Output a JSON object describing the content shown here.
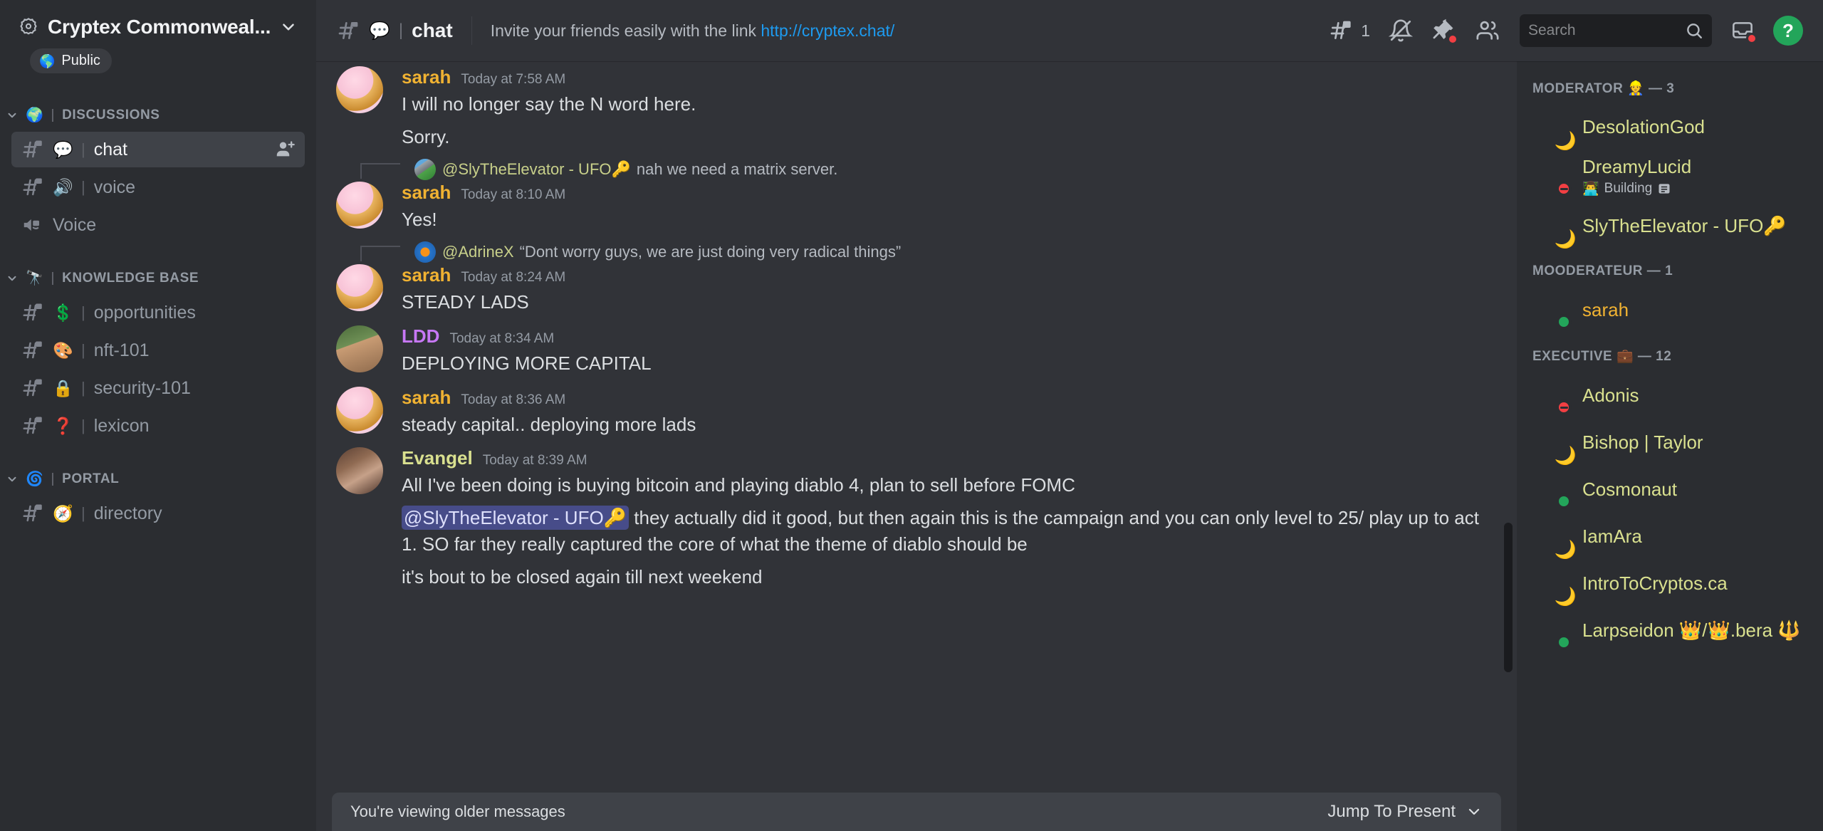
{
  "sidebar": {
    "server_name": "Cryptex Commonweal...",
    "privacy_label": "Public",
    "privacy_icon": "globe-icon",
    "categories": [
      {
        "label": "DISCUSSIONS",
        "emoji": "🌍",
        "channels": [
          {
            "emoji": "💬",
            "label": "chat",
            "active": true,
            "type": "text",
            "locked": true,
            "has_invite": true
          },
          {
            "emoji": "🔊",
            "label": "voice",
            "active": false,
            "type": "text",
            "locked": true,
            "has_invite": false
          },
          {
            "emoji": "",
            "label": "Voice",
            "active": false,
            "type": "voice",
            "locked": true,
            "has_invite": false
          }
        ]
      },
      {
        "label": "KNOWLEDGE BASE",
        "emoji": "🔭",
        "channels": [
          {
            "emoji": "💲",
            "label": "opportunities",
            "active": false,
            "type": "text",
            "locked": true,
            "has_invite": false
          },
          {
            "emoji": "🎨",
            "label": "nft-101",
            "active": false,
            "type": "text",
            "locked": true,
            "has_invite": false
          },
          {
            "emoji": "🔒",
            "label": "security-101",
            "active": false,
            "type": "text",
            "locked": true,
            "has_invite": false
          },
          {
            "emoji": "❓",
            "label": "lexicon",
            "active": false,
            "type": "text",
            "locked": true,
            "has_invite": false
          }
        ]
      },
      {
        "label": "PORTAL",
        "emoji": "🌀",
        "channels": [
          {
            "emoji": "🧭",
            "label": "directory",
            "active": false,
            "type": "text",
            "locked": true,
            "has_invite": false
          }
        ]
      }
    ]
  },
  "topbar": {
    "channel_emoji": "💬",
    "channel_name": "chat",
    "topic_prefix": "Invite your friends easily with the link",
    "topic_link": "http://cryptex.chat/",
    "threads_count": "1",
    "search_placeholder": "Search",
    "help_label": "?",
    "icons": [
      "threads-icon",
      "notification-off-icon",
      "pin-icon",
      "members-icon",
      "inbox-icon",
      "help-icon"
    ]
  },
  "messages": [
    {
      "id": "m1",
      "author": "sarah",
      "author_color": "#f0b232",
      "timestamp": "Today at 7:58 AM",
      "avatar_seed": "sarah",
      "lines": [
        "I will no longer say the N word here.",
        "Sorry."
      ],
      "reply": null
    },
    {
      "id": "m2",
      "author": "sarah",
      "author_color": "#f0b232",
      "timestamp": "Today at 8:10 AM",
      "avatar_seed": "sarah",
      "lines": [
        "Yes!"
      ],
      "reply": {
        "name": "@SlyTheElevator - UFO🔑",
        "text": "nah we need a matrix server.",
        "avatar_seed": "sly"
      }
    },
    {
      "id": "m3",
      "author": "sarah",
      "author_color": "#f0b232",
      "timestamp": "Today at 8:24 AM",
      "avatar_seed": "sarah",
      "lines": [
        "STEADY LADS"
      ],
      "reply": {
        "name": "@AdrineX",
        "text": "“Dont worry guys, we are just doing very radical things”",
        "avatar_seed": "adrine"
      }
    },
    {
      "id": "m4",
      "author": "LDD",
      "author_color": "#c778f5",
      "timestamp": "Today at 8:34 AM",
      "avatar_seed": "ldd",
      "lines": [
        "DEPLOYING MORE CAPITAL"
      ],
      "reply": null
    },
    {
      "id": "m5",
      "author": "sarah",
      "author_color": "#f0b232",
      "timestamp": "Today at 8:36 AM",
      "avatar_seed": "sarah",
      "lines": [
        "steady capital.. deploying more lads"
      ],
      "reply": null
    },
    {
      "id": "m6",
      "author": "Evangel",
      "author_color": "#d9e08f",
      "timestamp": "Today at 8:39 AM",
      "avatar_seed": "evangel",
      "lines": [],
      "reply": null,
      "rich_lines": [
        {
          "parts": [
            {
              "type": "text",
              "value": "All I've been doing is buying bitcoin and playing diablo 4, plan to sell before FOMC"
            }
          ]
        },
        {
          "parts": [
            {
              "type": "mention",
              "value": "@SlyTheElevator - UFO🔑"
            },
            {
              "type": "text",
              "value": " they actually did it good, but then again this is the campaign and you can only level to 25/ play up to act 1. SO far they really captured the core of what the theme of diablo should be"
            }
          ]
        },
        {
          "parts": [
            {
              "type": "text",
              "value": "it's bout to be closed again till next weekend"
            }
          ]
        }
      ]
    }
  ],
  "jump_bar": {
    "notice": "You're viewing older messages",
    "action_label": "Jump To Present"
  },
  "members": {
    "groups": [
      {
        "label": "MODERATOR 👷 — 3",
        "people": [
          {
            "name": "DesolationGod",
            "status": "idle",
            "status_glyph": "🌙",
            "activity": null,
            "avatar_seed": "desolation",
            "color": "green"
          },
          {
            "name": "DreamyLucid",
            "status": "dnd",
            "status_glyph": "",
            "activity": "Building",
            "activity_emoji": "👨‍💻",
            "activity_icon": "doc-icon",
            "avatar_seed": "dreamy",
            "color": "green"
          },
          {
            "name": "SlyTheElevator - UFO🔑",
            "status": "idle",
            "status_glyph": "🌙",
            "activity": null,
            "avatar_seed": "sly",
            "color": "green"
          }
        ]
      },
      {
        "label": "MOODERATEUR — 1",
        "people": [
          {
            "name": "sarah",
            "status": "online",
            "status_glyph": "",
            "activity": null,
            "avatar_seed": "sarah",
            "color": "yellow"
          }
        ]
      },
      {
        "label": "EXECUTIVE 💼 — 12",
        "people": [
          {
            "name": "Adonis",
            "status": "dnd",
            "status_glyph": "",
            "activity": null,
            "avatar_seed": "adonis",
            "color": "green"
          },
          {
            "name": "Bishop | Taylor",
            "status": "idle",
            "status_glyph": "🌙",
            "activity": null,
            "avatar_seed": "bishop",
            "color": "green"
          },
          {
            "name": "Cosmonaut",
            "status": "online",
            "status_glyph": "",
            "activity": null,
            "avatar_seed": "cosmonaut",
            "color": "green"
          },
          {
            "name": "IamAra",
            "status": "idle",
            "status_glyph": "🌙",
            "activity": null,
            "avatar_seed": "iamara",
            "color": "green"
          },
          {
            "name": "IntroToCryptos.ca",
            "status": "idle",
            "status_glyph": "🌙",
            "activity": null,
            "avatar_seed": "intro",
            "color": "green"
          },
          {
            "name": "Larpseidon 👑/👑.bera 🔱",
            "status": "online",
            "status_glyph": "",
            "activity": null,
            "avatar_seed": "larp",
            "color": "green"
          }
        ]
      }
    ]
  }
}
